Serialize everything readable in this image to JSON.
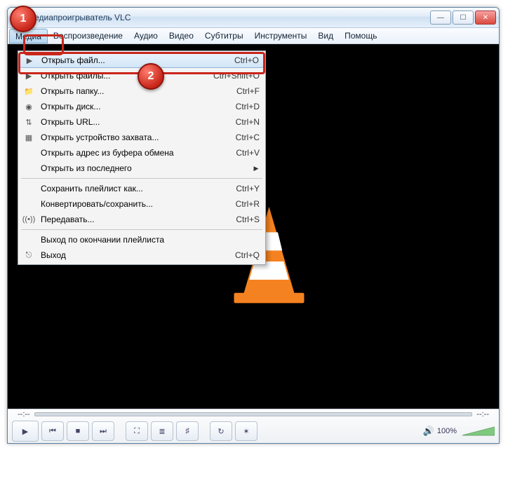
{
  "window": {
    "title": "Медиапроигрыватель VLC"
  },
  "callouts": {
    "one": "1",
    "two": "2"
  },
  "menubar": {
    "items": [
      "Медиа",
      "Воспроизведение",
      "Аудио",
      "Видео",
      "Субтитры",
      "Инструменты",
      "Вид",
      "Помощь"
    ]
  },
  "dropdown": {
    "items": [
      {
        "icon": "play-file",
        "label": "Открыть файл...",
        "shortcut": "Ctrl+O",
        "hl": true
      },
      {
        "icon": "play-files",
        "label": "Открыть файлы...",
        "shortcut": "Ctrl+Shift+O"
      },
      {
        "icon": "folder",
        "label": "Открыть папку...",
        "shortcut": "Ctrl+F"
      },
      {
        "icon": "disc",
        "label": "Открыть диск...",
        "shortcut": "Ctrl+D"
      },
      {
        "icon": "network",
        "label": "Открыть URL...",
        "shortcut": "Ctrl+N"
      },
      {
        "icon": "capture",
        "label": "Открыть устройство захвата...",
        "shortcut": "Ctrl+C"
      },
      {
        "icon": "",
        "label": "Открыть адрес из буфера обмена",
        "shortcut": "Ctrl+V"
      },
      {
        "icon": "",
        "label": "Открыть из последнего",
        "shortcut": "",
        "submenu": true
      },
      {
        "sep": true
      },
      {
        "icon": "",
        "label": "Сохранить плейлист как...",
        "shortcut": "Ctrl+Y"
      },
      {
        "icon": "",
        "label": "Конвертировать/сохранить...",
        "shortcut": "Ctrl+R"
      },
      {
        "icon": "stream",
        "label": "Передавать...",
        "shortcut": "Ctrl+S"
      },
      {
        "sep": true
      },
      {
        "icon": "",
        "label": "Выход по окончании плейлиста",
        "shortcut": ""
      },
      {
        "icon": "exit",
        "label": "Выход",
        "shortcut": "Ctrl+Q"
      }
    ]
  },
  "controls": {
    "time_start": "--:--",
    "time_end": "--:--",
    "volume_label": "100%"
  },
  "icons": {
    "play": "▶",
    "prev": "⏮",
    "stop": "■",
    "next": "⏭",
    "fullscreen": "⛶",
    "ext": "≣",
    "eq": "♯",
    "loop": "↻",
    "shuffle": "✶",
    "speaker": "🔊",
    "folder": "📁",
    "disc": "◉",
    "network": "⇅",
    "capture": "▦",
    "stream": "((•))",
    "exit": "⎋"
  }
}
